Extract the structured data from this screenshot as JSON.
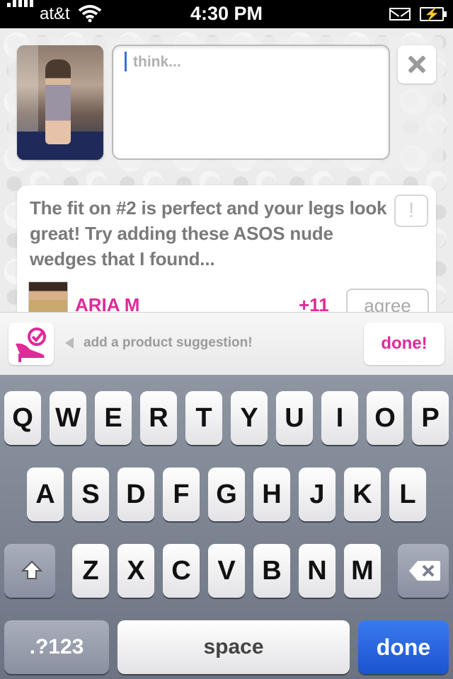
{
  "status_bar": {
    "carrier": "at&t",
    "time": "4:30 PM"
  },
  "compose": {
    "placeholder": "think..."
  },
  "suggestion_card": {
    "text": "The fit on #2 is perfect and your legs look great!  Try adding these ASOS nude wedges that I found...",
    "flag_label": "!",
    "user_name": "ARIA M",
    "score": "+11",
    "agree_label": "agree"
  },
  "suggest_bar": {
    "label": "add a product suggestion!",
    "done_label": "done!"
  },
  "colors": {
    "accent": "#e02a9a",
    "keyboard_blue": "#1b54cf"
  },
  "keyboard": {
    "row1": [
      "Q",
      "W",
      "E",
      "R",
      "T",
      "Y",
      "U",
      "I",
      "O",
      "P"
    ],
    "row2": [
      "A",
      "S",
      "D",
      "F",
      "G",
      "H",
      "J",
      "K",
      "L"
    ],
    "row3": [
      "Z",
      "X",
      "C",
      "V",
      "B",
      "N",
      "M"
    ],
    "numbers_label": ".?123",
    "space_label": "space",
    "done_label": "done"
  }
}
